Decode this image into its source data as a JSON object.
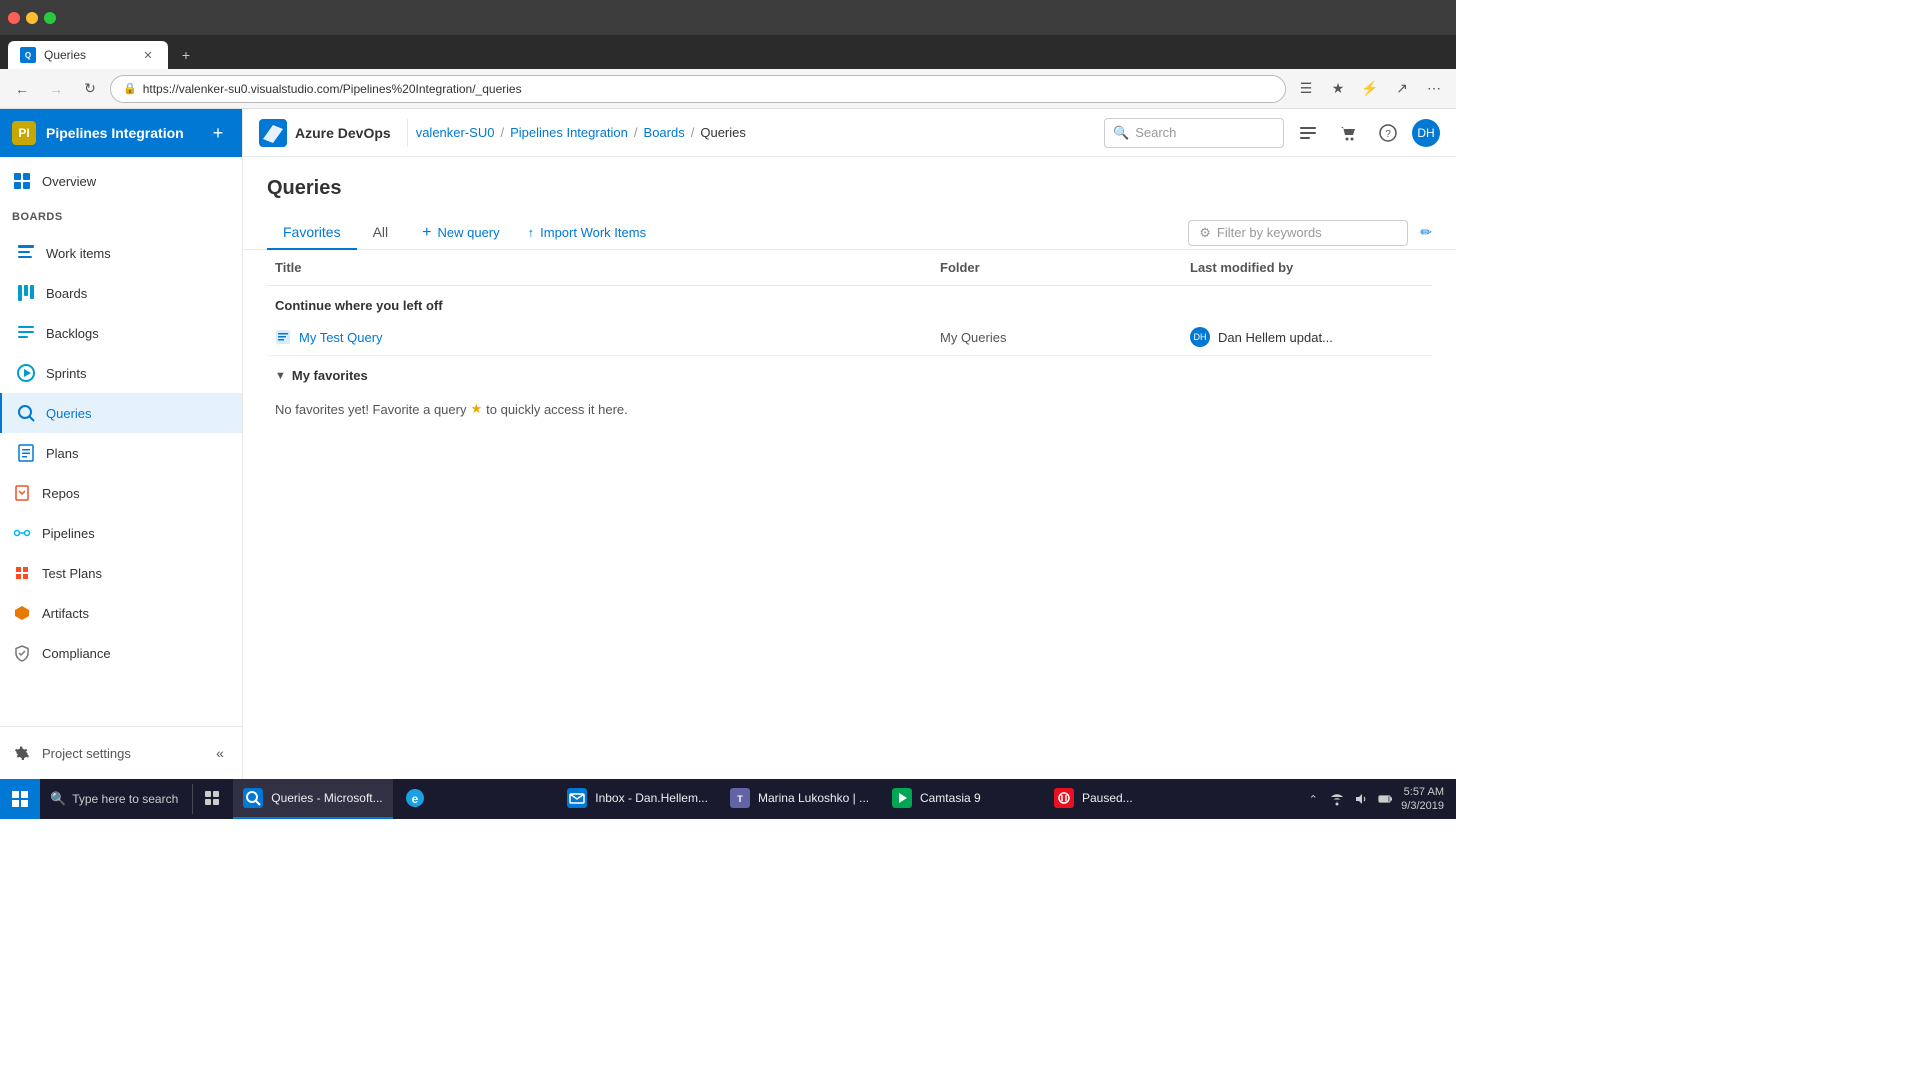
{
  "browser": {
    "tab_label": "Queries",
    "url": "https://valenker-su0.visualstudio.com/Pipelines%20Integration/_queries",
    "back_disabled": false,
    "forward_disabled": false
  },
  "topbar": {
    "logo_text": "Azure DevOps",
    "breadcrumb": [
      {
        "label": "valenker-SU0",
        "url": "#"
      },
      {
        "label": "Pipelines Integration",
        "url": "#"
      },
      {
        "label": "Boards",
        "url": "#"
      },
      {
        "label": "Queries",
        "current": true
      }
    ],
    "search_placeholder": "Search",
    "avatar_initials": "DH"
  },
  "sidebar": {
    "project_name": "Pipelines Integration",
    "project_icon": "PI",
    "nav_items": [
      {
        "id": "overview",
        "label": "Overview",
        "icon": "overview"
      },
      {
        "id": "boards",
        "label": "Boards",
        "icon": "boards"
      },
      {
        "id": "work-items",
        "label": "Work items",
        "icon": "workitems"
      },
      {
        "id": "boards2",
        "label": "Boards",
        "icon": "boards"
      },
      {
        "id": "backlogs",
        "label": "Backlogs",
        "icon": "backlogs"
      },
      {
        "id": "sprints",
        "label": "Sprints",
        "icon": "sprints"
      },
      {
        "id": "queries",
        "label": "Queries",
        "icon": "queries",
        "active": true
      },
      {
        "id": "plans",
        "label": "Plans",
        "icon": "plans"
      },
      {
        "id": "repos",
        "label": "Repos",
        "icon": "repos"
      },
      {
        "id": "pipelines",
        "label": "Pipelines",
        "icon": "pipelines"
      },
      {
        "id": "test-plans",
        "label": "Test Plans",
        "icon": "testplans"
      },
      {
        "id": "artifacts",
        "label": "Artifacts",
        "icon": "artifacts"
      },
      {
        "id": "compliance",
        "label": "Compliance",
        "icon": "compliance"
      }
    ],
    "footer": {
      "settings_label": "Project settings",
      "collapse_label": "Collapse"
    }
  },
  "page": {
    "title": "Queries",
    "tabs": [
      {
        "id": "favorites",
        "label": "Favorites",
        "active": true
      },
      {
        "id": "all",
        "label": "All",
        "active": false
      }
    ],
    "actions": [
      {
        "id": "new-query",
        "label": "New query",
        "icon": "+"
      },
      {
        "id": "import-work-items",
        "label": "Import Work Items",
        "icon": "import"
      }
    ],
    "filter_placeholder": "Filter by keywords",
    "table": {
      "columns": [
        "Title",
        "Folder",
        "Last modified by"
      ],
      "sections": [
        {
          "id": "continue-where-left",
          "title": "Continue where you left off",
          "expanded": true,
          "rows": [
            {
              "title": "My Test Query",
              "folder": "My Queries",
              "modified_by": "Dan Hellem updat...",
              "modified_avatar": "DH"
            }
          ]
        },
        {
          "id": "my-favorites",
          "title": "My favorites",
          "expanded": true,
          "rows": [],
          "empty_message": "No favorites yet! Favorite a query",
          "empty_message_suffix": "to quickly access it here."
        }
      ]
    }
  },
  "taskbar": {
    "apps": [
      {
        "id": "queries-tab",
        "label": "Queries - Microsoft...",
        "icon": "browser",
        "active": true
      },
      {
        "id": "ie-tab",
        "label": "",
        "icon": "ie"
      },
      {
        "id": "inbox-tab",
        "label": "Inbox - Dan.Hellem...",
        "icon": "outlook"
      },
      {
        "id": "marina-tab",
        "label": "Marina Lukoshko | ...",
        "icon": "teams"
      },
      {
        "id": "camtasia-tab",
        "label": "Camtasia 9",
        "icon": "camtasia"
      },
      {
        "id": "paused-tab",
        "label": "Paused...",
        "icon": "record"
      }
    ],
    "tray": {
      "time": "5:57 AM",
      "date": "9/3/2019"
    }
  }
}
